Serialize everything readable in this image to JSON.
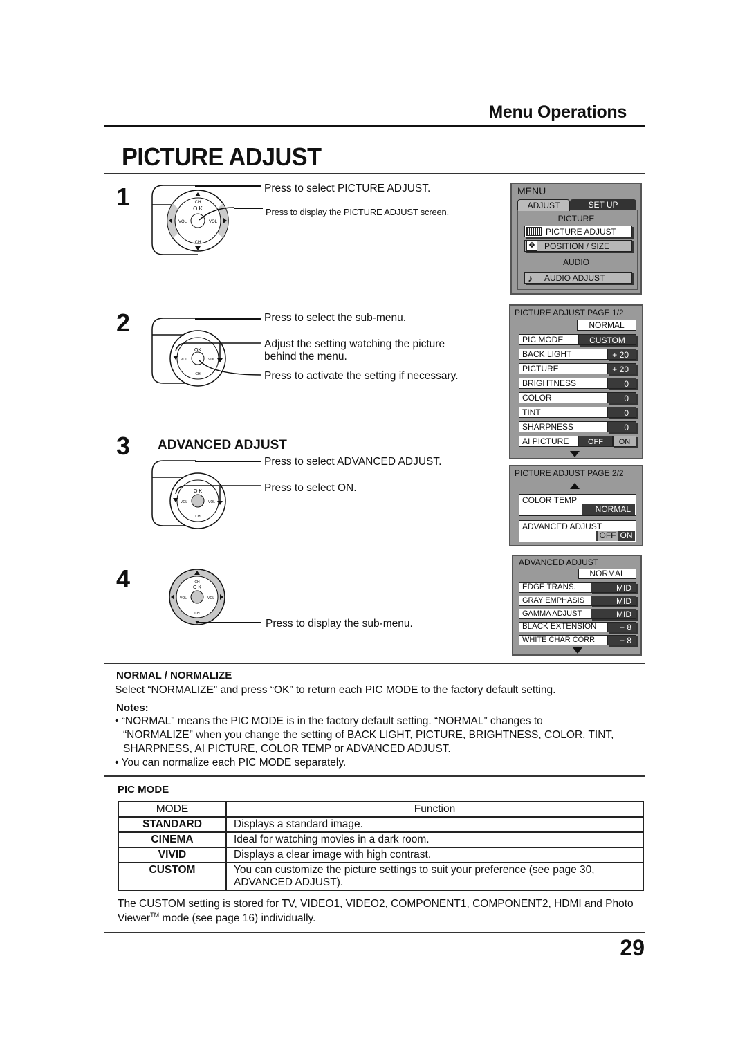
{
  "header": {
    "section": "Menu Operations",
    "title": "PICTURE ADJUST"
  },
  "steps": [
    {
      "num": "1",
      "lines": [
        "Press to select PICTURE ADJUST.",
        "Press to display the PICTURE ADJUST screen."
      ]
    },
    {
      "num": "2",
      "lines": [
        "Press to select the sub-menu.",
        "Adjust the setting watching the picture",
        "behind the menu.",
        "Press to activate the setting if necessary."
      ]
    },
    {
      "num": "3",
      "title": "ADVANCED ADJUST",
      "lines": [
        "Press to select ADVANCED ADJUST.",
        "Press to select ON."
      ]
    },
    {
      "num": "4",
      "lines": [
        "Press to display the sub-menu."
      ]
    }
  ],
  "remote": {
    "ch": "CH",
    "ok": "O K",
    "vol": "VOL"
  },
  "menu_main": {
    "title": "MENU",
    "tabs": [
      "ADJUST",
      "SET  UP"
    ],
    "group_picture": "PICTURE",
    "items": [
      {
        "icon": "picture-bars-icon",
        "label": "PICTURE  ADJUST",
        "selected": true
      },
      {
        "icon": "position-arrows-icon",
        "label": "POSITION / SIZE"
      }
    ],
    "group_audio": "AUDIO",
    "audio_item": {
      "icon": "music-note-icon",
      "label": "AUDIO  ADJUST"
    }
  },
  "menu_page1": {
    "title": "PICTURE  ADJUST  PAGE 1/2",
    "normal": "NORMAL",
    "pic_mode": {
      "label": "PIC  MODE",
      "value": "CUSTOM"
    },
    "rows": [
      {
        "label": "BACK  LIGHT",
        "value": "+ 20"
      },
      {
        "label": "PICTURE",
        "value": "+ 20"
      },
      {
        "label": "BRIGHTNESS",
        "value": "0"
      },
      {
        "label": "COLOR",
        "value": "0"
      },
      {
        "label": "TINT",
        "value": "0"
      },
      {
        "label": "SHARPNESS",
        "value": "0"
      }
    ],
    "ai_picture": {
      "label": "AI  PICTURE",
      "off": "OFF",
      "on": "ON",
      "selected": "ON"
    }
  },
  "menu_page2": {
    "title": "PICTURE  ADJUST  PAGE 2/2",
    "color_temp": {
      "label": "COLOR TEMP",
      "value": "NORMAL"
    },
    "advanced": {
      "label": "ADVANCED ADJUST",
      "off": "OFF",
      "on": "ON",
      "selected": "OFF"
    }
  },
  "menu_advanced": {
    "title": "ADVANCED ADJUST",
    "normal": "NORMAL",
    "rows": [
      {
        "label": "EDGE TRANS.",
        "value": "MID"
      },
      {
        "label": "GRAY EMPHASIS",
        "value": "MID"
      },
      {
        "label": "GAMMA ADJUST",
        "value": "MID"
      },
      {
        "label": "BLACK EXTENSION",
        "value": "+ 8"
      },
      {
        "label": "WHITE CHAR CORR",
        "value": "+ 8"
      }
    ]
  },
  "normalize": {
    "heading": "NORMAL / NORMALIZE",
    "text": "Select “NORMALIZE” and press “OK” to return each PIC MODE to the factory default setting.",
    "notes_label": "Notes:",
    "notes": [
      [
        "• “NORMAL” means the PIC MODE is in the factory default setting. “NORMAL” changes to",
        "“NORMALIZE” when you change the setting of BACK LIGHT, PICTURE, BRIGHTNESS, COLOR, TINT,",
        "SHARPNESS, AI PICTURE, COLOR TEMP or ADVANCED ADJUST."
      ],
      [
        "• You can normalize each PIC MODE separately."
      ]
    ]
  },
  "pic_mode": {
    "heading": "PIC MODE",
    "columns": [
      "MODE",
      "Function"
    ],
    "rows": [
      {
        "mode": "STANDARD",
        "function": [
          "Displays a standard image."
        ]
      },
      {
        "mode": "CINEMA",
        "function": [
          "Ideal for watching movies in a dark room."
        ]
      },
      {
        "mode": "VIVID",
        "function": [
          "Displays a clear image with high contrast."
        ]
      },
      {
        "mode": "CUSTOM",
        "function": [
          "You can customize the picture settings to suit your preference (see page 30,",
          "ADVANCED ADJUST)."
        ]
      }
    ],
    "footer": [
      "The CUSTOM setting is stored for TV, VIDEO1, VIDEO2, COMPONENT1, COMPONENT2, HDMI and Photo",
      "Viewer",
      "TM",
      " mode (see page 16) individually."
    ]
  },
  "page_number": "29"
}
